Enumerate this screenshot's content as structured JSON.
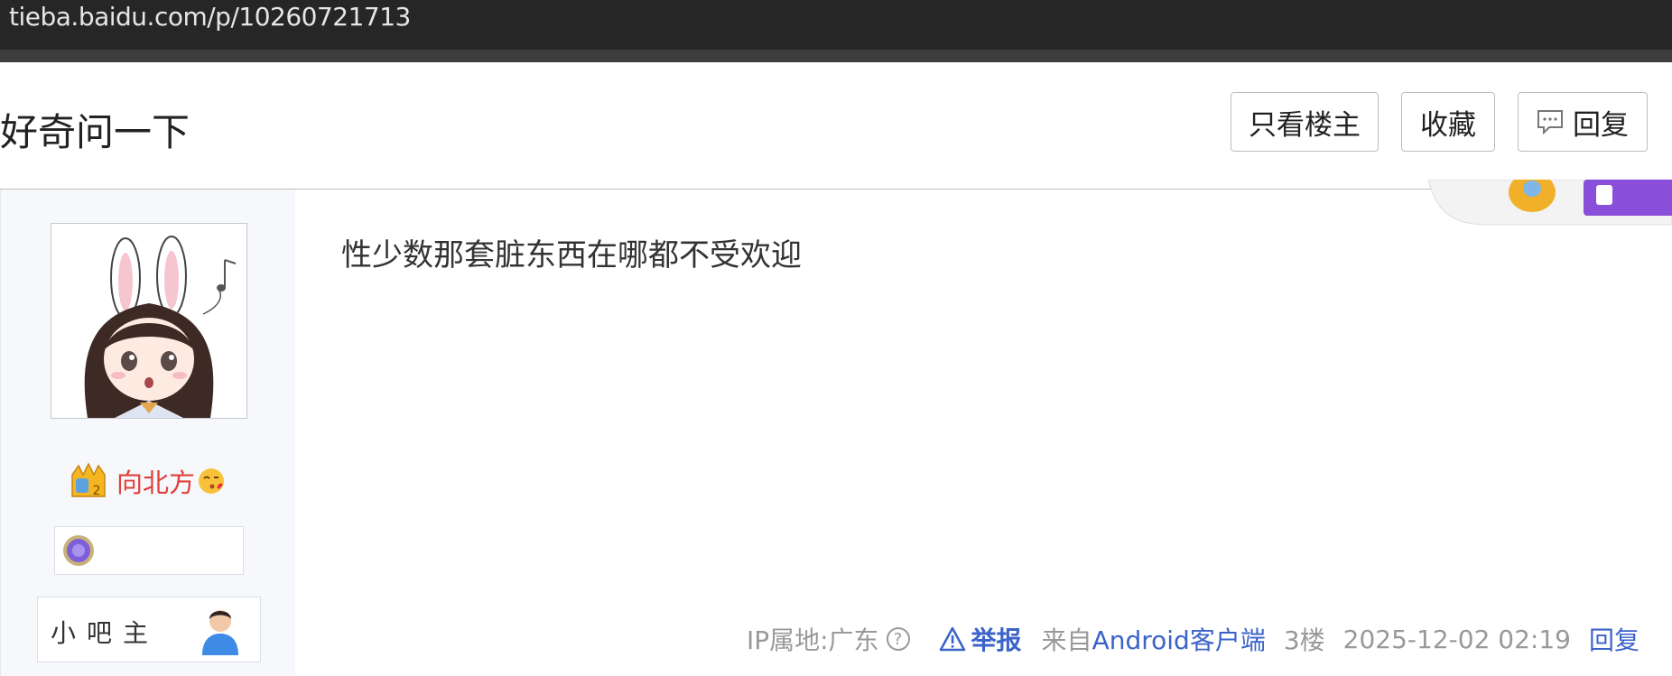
{
  "browser": {
    "url": "tieba.baidu.com/p/10260721713"
  },
  "thread": {
    "title": "好奇问一下",
    "buttons": {
      "only_op": "只看楼主",
      "favorite": "收藏",
      "reply": "回复"
    }
  },
  "author": {
    "name": "向北方",
    "role": "小吧主"
  },
  "post": {
    "text": "性少数那套脏东西在哪都不受欢迎",
    "footer": {
      "ip": "IP属地:广东",
      "help": "?",
      "report": "举报",
      "from_prefix": "来自",
      "client": "Android客户端",
      "floor": "3楼",
      "time": "2025-12-02 02:19",
      "reply": "回复"
    }
  },
  "colors": {
    "link": "#3b63c9",
    "username": "#e0403a",
    "sidebar_bg": "#f6f8fc"
  },
  "icons": [
    "comment-icon",
    "warning-icon",
    "crown-level-icon",
    "kiss-emoji-icon",
    "medal-icon",
    "moderator-icon"
  ]
}
